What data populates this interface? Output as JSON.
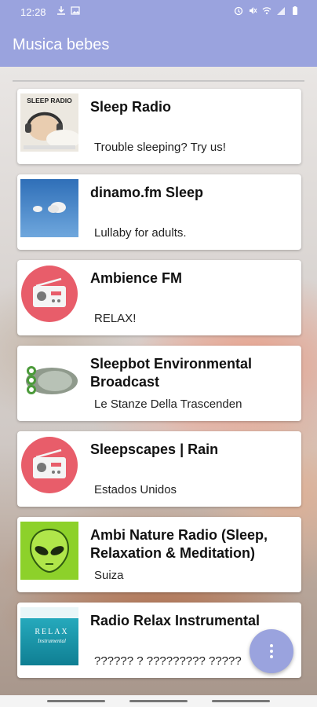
{
  "status_bar": {
    "time": "12:28",
    "left_icons": [
      "download-icon",
      "image-icon"
    ],
    "right_icons": [
      "alarm-icon",
      "mute-icon",
      "wifi-icon",
      "signal-icon",
      "battery-icon"
    ]
  },
  "app_bar": {
    "title": "Musica bebes"
  },
  "stations": [
    {
      "title": "Sleep Radio",
      "subtitle": "Trouble sleeping? Try us!",
      "thumb_icon": "sleep-radio-logo",
      "thumb_text": "SLEEP RADIO"
    },
    {
      "title": "dinamo.fm Sleep",
      "subtitle": "Lullaby for adults.",
      "thumb_icon": "clouds-sky-image"
    },
    {
      "title": "Ambience FM",
      "subtitle": "RELAX!",
      "thumb_icon": "radio-icon"
    },
    {
      "title": "Sleepbot Environmental Broadcast",
      "subtitle": "Le Stanze Della Trascenden",
      "thumb_icon": "sleepbot-logo"
    },
    {
      "title": "Sleepscapes | Rain",
      "subtitle": "Estados Unidos",
      "thumb_icon": "radio-icon"
    },
    {
      "title": "Ambi Nature Radio (Sleep, Relaxation & Meditation)",
      "subtitle": "Suiza",
      "thumb_icon": "alien-face-image"
    },
    {
      "title": "Radio Relax Instrumental",
      "subtitle": "?????? ? ????????? ?????",
      "thumb_icon": "relax-instrumental-logo",
      "thumb_text": "RELAX",
      "thumb_text2": "Instrumental"
    }
  ],
  "fab": {
    "icon": "more-vert-icon"
  },
  "colors": {
    "primary": "#9aa3de",
    "radio_icon_bg": "#e85d6a",
    "card_bg": "#ffffff"
  }
}
